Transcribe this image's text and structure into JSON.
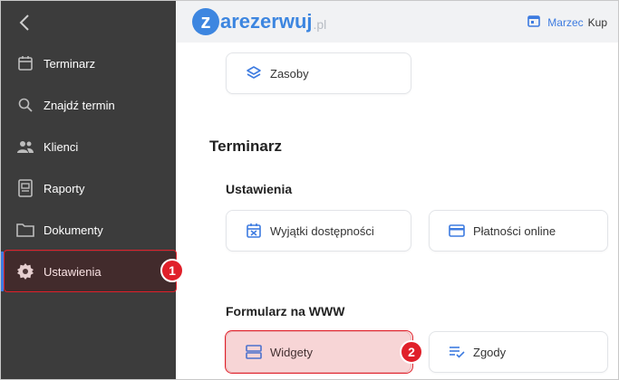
{
  "sidebar": {
    "items": [
      {
        "label": "Terminarz",
        "icon": "calendar-icon"
      },
      {
        "label": "Znajdź termin",
        "icon": "search-icon"
      },
      {
        "label": "Klienci",
        "icon": "people-icon"
      },
      {
        "label": "Raporty",
        "icon": "report-icon"
      },
      {
        "label": "Dokumenty",
        "icon": "folder-icon"
      },
      {
        "label": "Ustawienia",
        "icon": "gear-icon"
      }
    ]
  },
  "header": {
    "logo_letter": "z",
    "logo_text": "arezerwuj",
    "logo_suffix": ".pl",
    "month": "Marzec",
    "user": "Kup"
  },
  "content": {
    "top_card": "Zasoby",
    "section_title": "Terminarz",
    "settings_heading": "Ustawienia",
    "settings_cards": [
      "Wyjątki dostępności",
      "Płatności online"
    ],
    "form_heading": "Formularz na WWW",
    "form_cards": [
      "Widgety",
      "Zgody"
    ]
  },
  "annotations": {
    "step1": "1",
    "step2": "2"
  },
  "colors": {
    "accent": "#3d7be0",
    "highlight": "#e0202a",
    "sidebar": "#3c3c3c"
  }
}
